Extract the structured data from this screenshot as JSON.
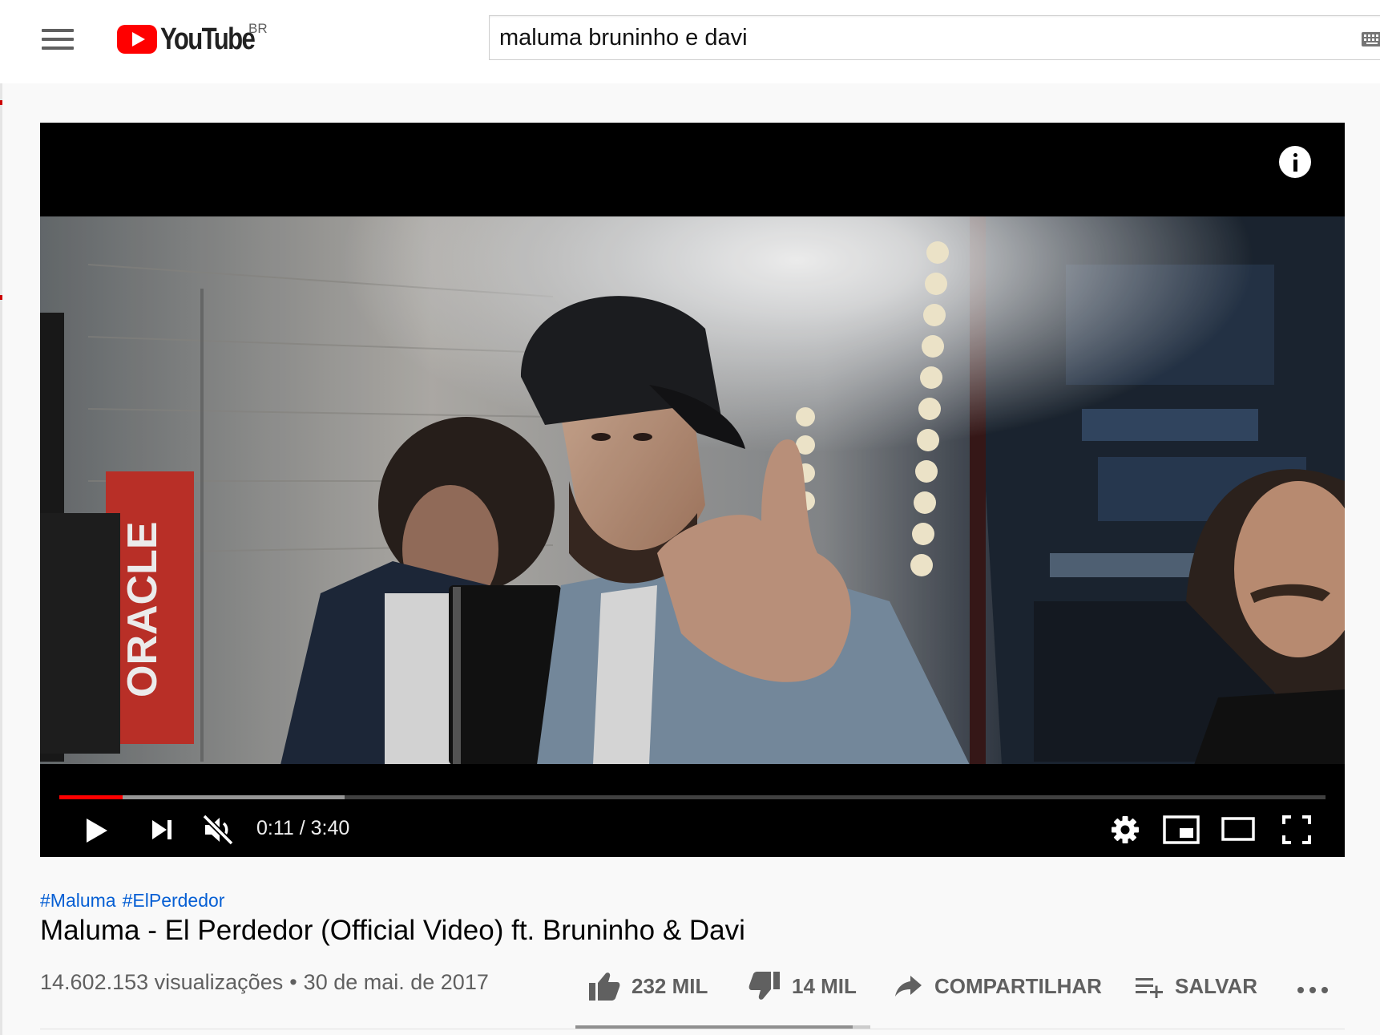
{
  "header": {
    "logo_text": "YouTube",
    "region": "BR",
    "search_value": "maluma bruninho e davi"
  },
  "player": {
    "current_time": "0:11",
    "duration": "3:40",
    "time_display": "0:11 / 3:40",
    "progress_played_fraction": 0.05,
    "progress_buffered_fraction": 0.225,
    "muted": true
  },
  "video": {
    "hashtags": [
      "#Maluma",
      "#ElPerdedor"
    ],
    "title": "Maluma - El Perdedor (Official Video) ft. Bruninho & Davi",
    "views": "14.602.153 visualizações",
    "separator": "•",
    "date": "30 de mai. de 2017",
    "sentiment_like_fraction": 0.94
  },
  "actions": {
    "like_count": "232 MIL",
    "dislike_count": "14 MIL",
    "share_label": "COMPARTILHAR",
    "save_label": "SALVAR"
  },
  "colors": {
    "brand_red": "#ff0000",
    "link_blue": "#065fd4",
    "secondary_text": "#606060"
  }
}
